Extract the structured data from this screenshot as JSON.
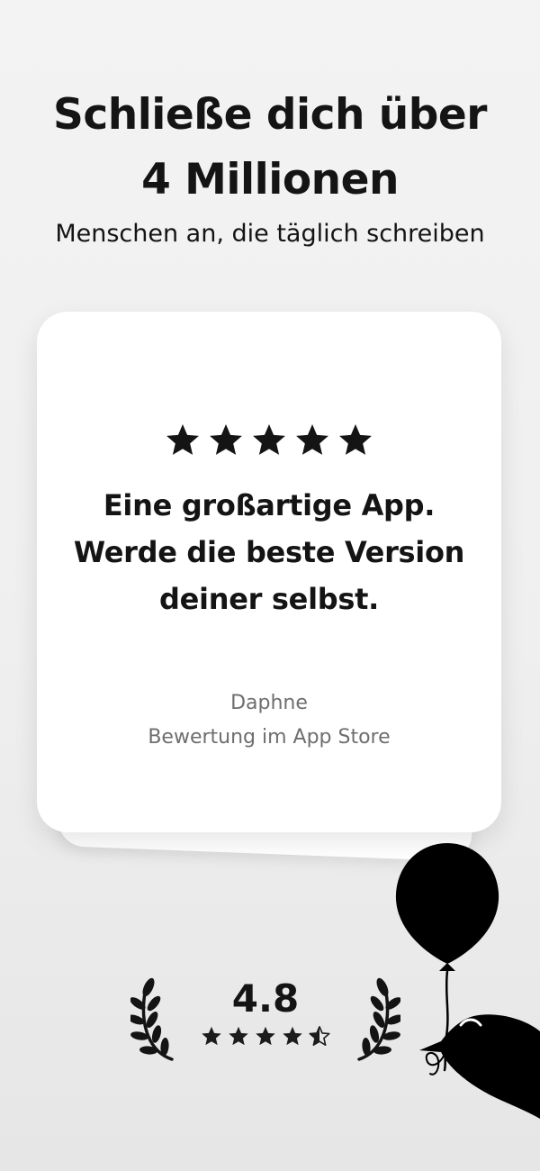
{
  "header": {
    "title_line1": "Schließe dich über",
    "title_line2": "4 Millionen",
    "subtitle": "Menschen an, die täglich schreiben"
  },
  "review_card": {
    "stars": 5,
    "quote_lines": [
      "Eine großartige App.",
      "Werde die beste Version",
      "deiner selbst."
    ],
    "reviewer_name": "Daphne",
    "review_source": "Bewertung im App Store"
  },
  "rating_badge": {
    "value": "4.8",
    "stars_filled": 4.5,
    "stars_total": 5,
    "icons": [
      "laurel-left-icon",
      "laurel-right-icon",
      "star-icon"
    ]
  },
  "illustration": {
    "description_icons": [
      "balloon-icon",
      "bird-icon"
    ]
  },
  "colors": {
    "background": "#f0f0f0",
    "text": "#141414",
    "muted_text": "#6e6e6e",
    "card": "#ffffff"
  }
}
